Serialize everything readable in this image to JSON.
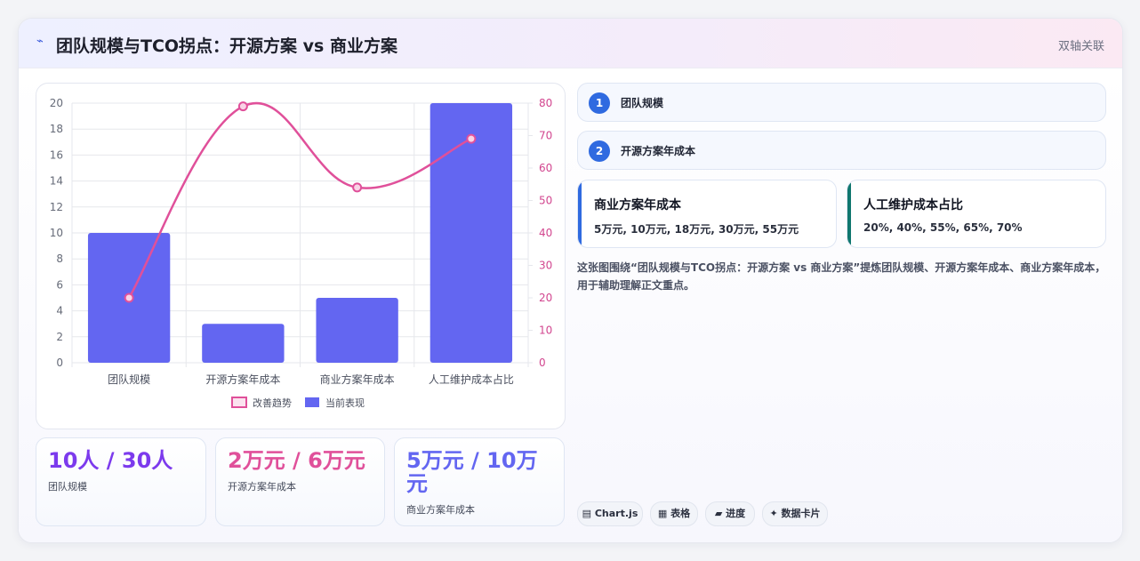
{
  "header": {
    "icon": "chart-line-icon",
    "title": "团队规模与TCO拐点：开源方案 vs 商业方案",
    "tag": "双轴关联"
  },
  "chart_data": {
    "type": "bar",
    "categories": [
      "团队规模",
      "开源方案年成本",
      "商业方案年成本",
      "人工维护成本占比"
    ],
    "series": [
      {
        "name": "当前表现",
        "type": "bar",
        "axis": "left",
        "color": "#6366f1",
        "values": [
          10,
          3,
          5,
          20
        ]
      },
      {
        "name": "改善趋势",
        "type": "line",
        "axis": "right",
        "color": "#e0509a",
        "values": [
          20,
          79,
          54,
          69
        ]
      }
    ],
    "y_left": {
      "min": 0,
      "max": 20,
      "ticks": [
        0,
        2,
        4,
        6,
        8,
        10,
        12,
        14,
        16,
        18,
        20
      ]
    },
    "y_right": {
      "min": 0,
      "max": 80,
      "ticks": [
        0,
        10,
        20,
        30,
        40,
        50,
        60,
        70,
        80
      ]
    },
    "grid": true,
    "legend": "bottom"
  },
  "stats": [
    {
      "value": "10人 / 30人",
      "label": "团队规模",
      "color": "#7c3aed"
    },
    {
      "value": "2万元 / 6万元",
      "label": "开源方案年成本",
      "color": "#e0509a"
    },
    {
      "value": "5万元 / 10万元",
      "label": "商业方案年成本",
      "color": "#6366f1"
    }
  ],
  "items": [
    {
      "num": "1",
      "label": "团队规模"
    },
    {
      "num": "2",
      "label": "开源方案年成本"
    }
  ],
  "info_cards": [
    {
      "title": "商业方案年成本",
      "values": "5万元, 10万元, 18万元, 30万元, 55万元",
      "accent": "#2f6ae0"
    },
    {
      "title": "人工维护成本占比",
      "values": "20%, 40%, 55%, 65%, 70%",
      "accent": "#0f766e"
    }
  ],
  "description": "这张图围绕“团队规模与TCO拐点：开源方案 vs 商业方案”提炼团队规模、开源方案年成本、商业方案年成本，用于辅助理解正文重点。",
  "chips": [
    {
      "icon": "chart-icon",
      "label": "Chart.js"
    },
    {
      "icon": "table-icon",
      "label": "表格"
    },
    {
      "icon": "progress-icon",
      "label": "进度"
    },
    {
      "icon": "sparkle-icon",
      "label": "数据卡片"
    }
  ]
}
